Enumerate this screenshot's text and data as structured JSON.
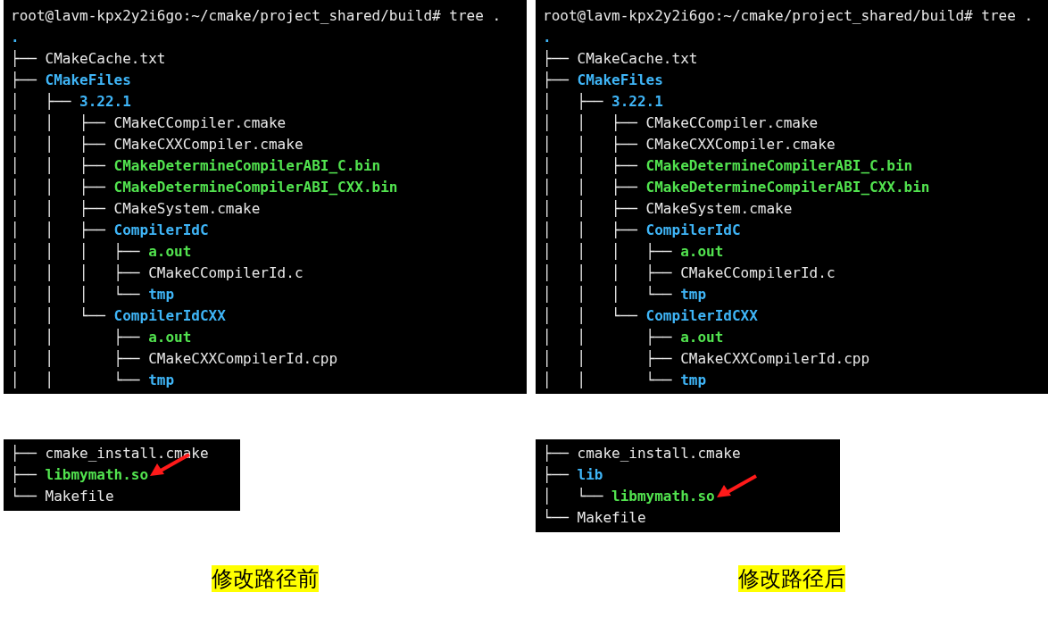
{
  "panels": [
    {
      "prompt": "root@lavm-kpx2y2i6go:~/cmake/project_shared/build# tree .",
      "root": ".",
      "lines": [
        {
          "prefix": "├── ",
          "name": "CMakeCache.txt",
          "kind": "file"
        },
        {
          "prefix": "├── ",
          "name": "CMakeFiles",
          "kind": "dir"
        },
        {
          "prefix": "│   ├── ",
          "name": "3.22.1",
          "kind": "dir"
        },
        {
          "prefix": "│   │   ├── ",
          "name": "CMakeCCompiler.cmake",
          "kind": "file"
        },
        {
          "prefix": "│   │   ├── ",
          "name": "CMakeCXXCompiler.cmake",
          "kind": "file"
        },
        {
          "prefix": "│   │   ├── ",
          "name": "CMakeDetermineCompilerABI_C.bin",
          "kind": "exec"
        },
        {
          "prefix": "│   │   ├── ",
          "name": "CMakeDetermineCompilerABI_CXX.bin",
          "kind": "exec"
        },
        {
          "prefix": "│   │   ├── ",
          "name": "CMakeSystem.cmake",
          "kind": "file"
        },
        {
          "prefix": "│   │   ├── ",
          "name": "CompilerIdC",
          "kind": "dir"
        },
        {
          "prefix": "│   │   │   ├── ",
          "name": "a.out",
          "kind": "exec"
        },
        {
          "prefix": "│   │   │   ├── ",
          "name": "CMakeCCompilerId.c",
          "kind": "file"
        },
        {
          "prefix": "│   │   │   └── ",
          "name": "tmp",
          "kind": "dir"
        },
        {
          "prefix": "│   │   └── ",
          "name": "CompilerIdCXX",
          "kind": "dir"
        },
        {
          "prefix": "│   │       ├── ",
          "name": "a.out",
          "kind": "exec"
        },
        {
          "prefix": "│   │       ├── ",
          "name": "CMakeCXXCompilerId.cpp",
          "kind": "file"
        },
        {
          "prefix": "│   │       └── ",
          "name": "tmp",
          "kind": "dir"
        }
      ],
      "snippet": [
        {
          "prefix": "├── ",
          "name": "cmake_install.cmake",
          "kind": "file",
          "marked": false
        },
        {
          "prefix": "├── ",
          "name": "libmymath.so",
          "kind": "exec",
          "marked": true
        },
        {
          "prefix": "└── ",
          "name": "Makefile",
          "kind": "file",
          "marked": false
        }
      ],
      "caption": "修改路径前"
    },
    {
      "prompt": "root@lavm-kpx2y2i6go:~/cmake/project_shared/build# tree .",
      "root": ".",
      "lines": [
        {
          "prefix": "├── ",
          "name": "CMakeCache.txt",
          "kind": "file"
        },
        {
          "prefix": "├── ",
          "name": "CMakeFiles",
          "kind": "dir"
        },
        {
          "prefix": "│   ├── ",
          "name": "3.22.1",
          "kind": "dir"
        },
        {
          "prefix": "│   │   ├── ",
          "name": "CMakeCCompiler.cmake",
          "kind": "file"
        },
        {
          "prefix": "│   │   ├── ",
          "name": "CMakeCXXCompiler.cmake",
          "kind": "file"
        },
        {
          "prefix": "│   │   ├── ",
          "name": "CMakeDetermineCompilerABI_C.bin",
          "kind": "exec"
        },
        {
          "prefix": "│   │   ├── ",
          "name": "CMakeDetermineCompilerABI_CXX.bin",
          "kind": "exec"
        },
        {
          "prefix": "│   │   ├── ",
          "name": "CMakeSystem.cmake",
          "kind": "file"
        },
        {
          "prefix": "│   │   ├── ",
          "name": "CompilerIdC",
          "kind": "dir"
        },
        {
          "prefix": "│   │   │   ├── ",
          "name": "a.out",
          "kind": "exec"
        },
        {
          "prefix": "│   │   │   ├── ",
          "name": "CMakeCCompilerId.c",
          "kind": "file"
        },
        {
          "prefix": "│   │   │   └── ",
          "name": "tmp",
          "kind": "dir"
        },
        {
          "prefix": "│   │   └── ",
          "name": "CompilerIdCXX",
          "kind": "dir"
        },
        {
          "prefix": "│   │       ├── ",
          "name": "a.out",
          "kind": "exec"
        },
        {
          "prefix": "│   │       ├── ",
          "name": "CMakeCXXCompilerId.cpp",
          "kind": "file"
        },
        {
          "prefix": "│   │       └── ",
          "name": "tmp",
          "kind": "dir"
        }
      ],
      "snippet": [
        {
          "prefix": "├── ",
          "name": "cmake_install.cmake",
          "kind": "file",
          "marked": false
        },
        {
          "prefix": "├── ",
          "name": "lib",
          "kind": "dir",
          "marked": false
        },
        {
          "prefix": "│   └── ",
          "name": "libmymath.so",
          "kind": "exec",
          "marked": true
        },
        {
          "prefix": "└── ",
          "name": "Makefile",
          "kind": "file",
          "marked": false
        }
      ],
      "caption": "修改路径后"
    }
  ]
}
